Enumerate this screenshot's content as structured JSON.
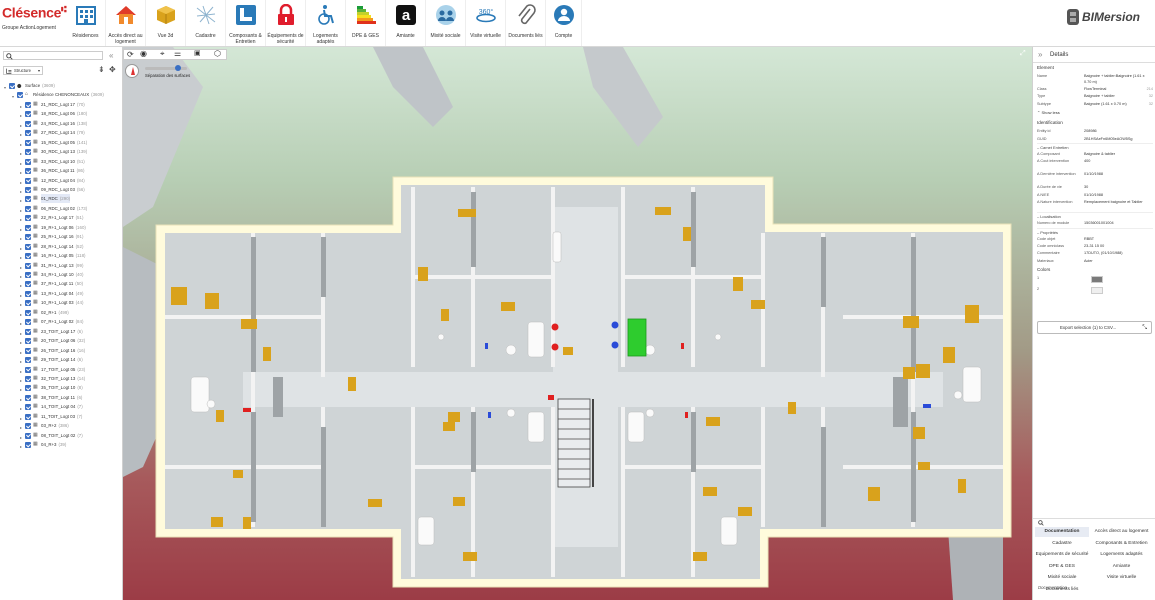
{
  "toolbar": {
    "brand": "Clésence",
    "brand_sub": "Groupe ActionLogement",
    "items": [
      {
        "label": "Résidences",
        "icon": "building-icon"
      },
      {
        "label": "Accès direct au logement",
        "icon": "home-icon"
      },
      {
        "label": "Vue 3d",
        "icon": "3d-view-icon"
      },
      {
        "label": "Cadastre",
        "icon": "cadastre-map-icon"
      },
      {
        "label": "Composants & Entretien",
        "icon": "components-icon"
      },
      {
        "label": "Équipements de sécurité",
        "icon": "lock-icon"
      },
      {
        "label": "Logements adaptés",
        "icon": "wheelchair-icon"
      },
      {
        "label": "DPE & GES",
        "icon": "energy-label-icon"
      },
      {
        "label": "Amiante",
        "icon": "asbestos-icon"
      },
      {
        "label": "Mixité sociale",
        "icon": "people-icon"
      },
      {
        "label": "Visite virtuelle",
        "icon": "360-icon"
      },
      {
        "label": "Documents liés",
        "icon": "paperclip-icon"
      },
      {
        "label": "Compte",
        "icon": "user-icon"
      }
    ],
    "bim_logo": "BIMersion"
  },
  "left_panel": {
    "search_placeholder": "",
    "structure_label": "Structure",
    "tree": [
      {
        "label": "Surface",
        "count": "(3609)",
        "level": 0,
        "kind": "root"
      },
      {
        "label": "Résidence CHENONCEAUX",
        "count": "(3609)",
        "level": 1,
        "kind": "residence"
      },
      {
        "label": "21_RDC_Logt 17",
        "count": "(70)",
        "level": 2
      },
      {
        "label": "18_RDC_Logt 06",
        "count": "(180)",
        "level": 2
      },
      {
        "label": "24_RDC_Logt 16",
        "count": "(138)",
        "level": 2
      },
      {
        "label": "27_RDC_Logt 14",
        "count": "(79)",
        "level": 2
      },
      {
        "label": "15_RDC_Logt 05",
        "count": "(141)",
        "level": 2
      },
      {
        "label": "30_RDC_Logt 13",
        "count": "(139)",
        "level": 2
      },
      {
        "label": "33_RDC_Logt 10",
        "count": "(51)",
        "level": 2
      },
      {
        "label": "36_RDC_Logt 11",
        "count": "(86)",
        "level": 2
      },
      {
        "label": "12_RDC_Logt 04",
        "count": "(84)",
        "level": 2
      },
      {
        "label": "09_RDC_Logt 03",
        "count": "(56)",
        "level": 2
      },
      {
        "label": "01_RDC",
        "count": "(290)",
        "level": 2,
        "selected": true
      },
      {
        "label": "06_RDC_Logt 02",
        "count": "(173)",
        "level": 2
      },
      {
        "label": "22_R+1_Logt 17",
        "count": "(51)",
        "level": 2
      },
      {
        "label": "19_R+1_Logt 06",
        "count": "(160)",
        "level": 2
      },
      {
        "label": "25_R+1_Logt 16",
        "count": "(91)",
        "level": 2
      },
      {
        "label": "28_R+1_Logt 14",
        "count": "(52)",
        "level": 2
      },
      {
        "label": "16_R+1_Logt 05",
        "count": "(118)",
        "level": 2
      },
      {
        "label": "31_R+1_Logt 13",
        "count": "(99)",
        "level": 2
      },
      {
        "label": "34_R+1_Logt 10",
        "count": "(40)",
        "level": 2
      },
      {
        "label": "37_R+1_Logt 11",
        "count": "(50)",
        "level": 2
      },
      {
        "label": "13_R+1_Logt 04",
        "count": "(49)",
        "level": 2
      },
      {
        "label": "10_R+1_Logt 03",
        "count": "(44)",
        "level": 2
      },
      {
        "label": "02_R+1",
        "count": "(499)",
        "level": 2
      },
      {
        "label": "07_R+1_Logt 02",
        "count": "(84)",
        "level": 2
      },
      {
        "label": "23_TOIT_Logt 17",
        "count": "(6)",
        "level": 2
      },
      {
        "label": "20_TOIT_Logt 06",
        "count": "(32)",
        "level": 2
      },
      {
        "label": "26_TOIT_Logt 16",
        "count": "(16)",
        "level": 2
      },
      {
        "label": "29_TOIT_Logt 14",
        "count": "(6)",
        "level": 2
      },
      {
        "label": "17_TOIT_Logt 05",
        "count": "(23)",
        "level": 2
      },
      {
        "label": "32_TOIT_Logt 13",
        "count": "(14)",
        "level": 2
      },
      {
        "label": "35_TOIT_Logt 10",
        "count": "(8)",
        "level": 2
      },
      {
        "label": "38_TOIT_Logt 11",
        "count": "(6)",
        "level": 2
      },
      {
        "label": "14_TOIT_Logt 04",
        "count": "(7)",
        "level": 2
      },
      {
        "label": "11_TOIT_Logt 03",
        "count": "(7)",
        "level": 2
      },
      {
        "label": "03_R+2",
        "count": "(386)",
        "level": 2
      },
      {
        "label": "08_TOIT_Logt 02",
        "count": "(7)",
        "level": 2
      },
      {
        "label": "04_R+3",
        "count": "(39)",
        "level": 2
      }
    ]
  },
  "viewport": {
    "slider_label": "Séparation des surfaces"
  },
  "right_panel": {
    "title": "Details",
    "element_header": "Element",
    "element": [
      {
        "k": "Name",
        "v": "Baignoire + tablier:Baignoire (1.61 x 0.70 m)",
        "n": ""
      },
      {
        "k": "Class",
        "v": "FlowTerminal",
        "n": "214"
      },
      {
        "k": "Type",
        "v": "Baignoire + tablier",
        "n": "32"
      },
      {
        "k": "Subtype",
        "v": "Baignoire (1.61 x 0.70 m)",
        "n": "32"
      }
    ],
    "show_less": "Show less",
    "identification_header": "Identification",
    "identification": [
      {
        "k": "Entity id",
        "v": "208986"
      },
      {
        "k": "GUID",
        "v": "2B1HSAeFn6M05eAOW5Sg"
      }
    ],
    "carnet_header": "Carnet Entretien",
    "carnet": [
      {
        "k": "A Composant",
        "v": "Baignoire & tablier"
      },
      {
        "k": "A Cout intervention",
        "v": "400"
      },
      {
        "k": "A Dernière intervention",
        "v": "01/10/1988"
      },
      {
        "k": "A Durée de vie",
        "v": "30"
      },
      {
        "k": "A NIEE",
        "v": "01/10/1988"
      },
      {
        "k": "A Nature intervention",
        "v": "Remplacement baignoire et Tablier"
      }
    ],
    "localisation_header": "Localisation",
    "localisation": [
      {
        "k": "Numero de module",
        "v": "15036001001004"
      }
    ],
    "proprietes_header": "Propriétés",
    "proprietes": [
      {
        "k": "Code objet",
        "v": "RBBT"
      },
      {
        "k": "Code omniclass",
        "v": "23-31 15 00"
      },
      {
        "k": "Commentaire",
        "v": "17DUTO, (01/10/1988)"
      },
      {
        "k": "Materiaux",
        "v": "Acier"
      }
    ],
    "colors_header": "Colors",
    "colors": [
      {
        "k": "1",
        "color": "#7a7a7a"
      },
      {
        "k": "2",
        "color": "#efefef"
      }
    ],
    "export_label": "Export selection (1) to CSV...",
    "bottom_tabs": [
      {
        "label": "Documentation",
        "active": true
      },
      {
        "label": "Accès direct au logement"
      },
      {
        "label": "Cadastre"
      },
      {
        "label": "Composants & Entretien"
      },
      {
        "label": "Equipements de sécurité"
      },
      {
        "label": "Logements adaptés"
      },
      {
        "label": "DPE & GES"
      },
      {
        "label": "Amiante"
      },
      {
        "label": "Mixité sociale"
      },
      {
        "label": "Visite virtuelle"
      },
      {
        "label": "Documents liés"
      }
    ],
    "bottom_title": "Documentation"
  },
  "colors": {
    "accent": "#3a6fc4",
    "brand": "#d32a2a",
    "bath_green": "#2ecc2e",
    "door_orange": "#d9a21c"
  }
}
